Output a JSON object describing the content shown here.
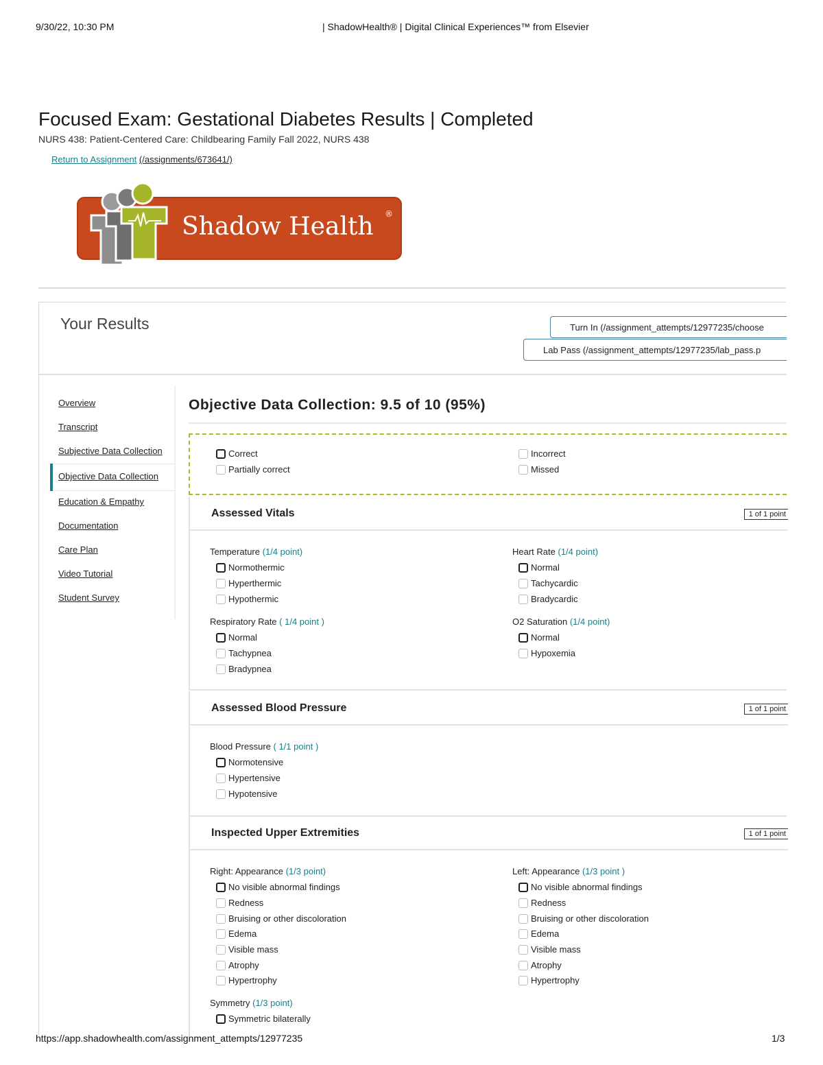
{
  "print_header": {
    "date": "9/30/22, 10:30 PM",
    "title": "| ShadowHealth® | Digital Clinical Experiences™ from Elsevier"
  },
  "page": {
    "title": "Focused Exam: Gestational Diabetes Results | Completed",
    "course": "NURS 438: Patient-Centered Care: Childbearing Family Fall 2022, NURS 438",
    "return_link": "Return to Assignment",
    "return_url": "(/assignments/673641/)"
  },
  "logo": {
    "text": "Shadow Health",
    "brand_color": "#c9491f",
    "accent_color": "#a6b42a"
  },
  "results": {
    "heading": "Your Results",
    "turn_in_label": "Turn In (/assignment_attempts/12977235/choose",
    "lab_pass_label": "Lab Pass (/assignment_attempts/12977235/lab_pass.p"
  },
  "sidebar": {
    "items": [
      {
        "label": "Overview"
      },
      {
        "label": "Transcript"
      },
      {
        "label": "Subjective Data Collection"
      },
      {
        "label": "Objective Data Collection",
        "active": true
      },
      {
        "label": "Education & Empathy"
      },
      {
        "label": "Documentation"
      },
      {
        "label": "Care Plan"
      },
      {
        "label": "Video Tutorial"
      },
      {
        "label": "Student Survey"
      }
    ]
  },
  "section": {
    "title": "Objective Data Collection: 9.5 of 10 (95%)"
  },
  "legend": {
    "correct": "Correct",
    "partially_correct": "Partially correct",
    "incorrect": "Incorrect",
    "missed": "Missed"
  },
  "panels": [
    {
      "title": "Assessed Vitals",
      "points": "1 of 1 point",
      "questions": [
        {
          "label": "Temperature",
          "points": "(1/4 point)",
          "options": [
            "Normothermic",
            "Hyperthermic",
            "Hypothermic"
          ],
          "correct": 0
        },
        {
          "label": "Heart Rate",
          "points": "(1/4 point)",
          "options": [
            "Normal",
            "Tachycardic",
            "Bradycardic"
          ],
          "correct": 0
        },
        {
          "label": "Respiratory Rate",
          "points": "( 1/4 point )",
          "options": [
            "Normal",
            "Tachypnea",
            "Bradypnea"
          ],
          "correct": 0
        },
        {
          "label": "O2 Saturation",
          "points": "(1/4 point)",
          "options": [
            "Normal",
            "Hypoxemia"
          ],
          "correct": 0
        }
      ]
    },
    {
      "title": "Assessed Blood Pressure",
      "points": "1 of 1 point",
      "questions": [
        {
          "label": "Blood Pressure",
          "points": "( 1/1 point )",
          "options": [
            "Normotensive",
            "Hypertensive",
            "Hypotensive"
          ],
          "correct": 0
        }
      ]
    },
    {
      "title": "Inspected Upper Extremities",
      "points": "1 of 1 point",
      "questions": [
        {
          "label": "Right: Appearance",
          "points": "(1/3 point)",
          "options": [
            "No visible abnormal findings",
            "Redness",
            "Bruising or other discoloration",
            "Edema",
            "Visible mass",
            "Atrophy",
            "Hypertrophy"
          ],
          "correct": 0
        },
        {
          "label": "Left: Appearance",
          "points": "(1/3 point )",
          "options": [
            "No visible abnormal findings",
            "Redness",
            "Bruising or other discoloration",
            "Edema",
            "Visible mass",
            "Atrophy",
            "Hypertrophy"
          ],
          "correct": 0
        },
        {
          "label": "Symmetry",
          "points": "(1/3 point)",
          "options": [
            "Symmetric bilaterally"
          ],
          "correct": 0
        }
      ]
    }
  ],
  "print_footer": {
    "url": "https://app.shadowhealth.com/assignment_attempts/12977235",
    "page": "1/3"
  }
}
